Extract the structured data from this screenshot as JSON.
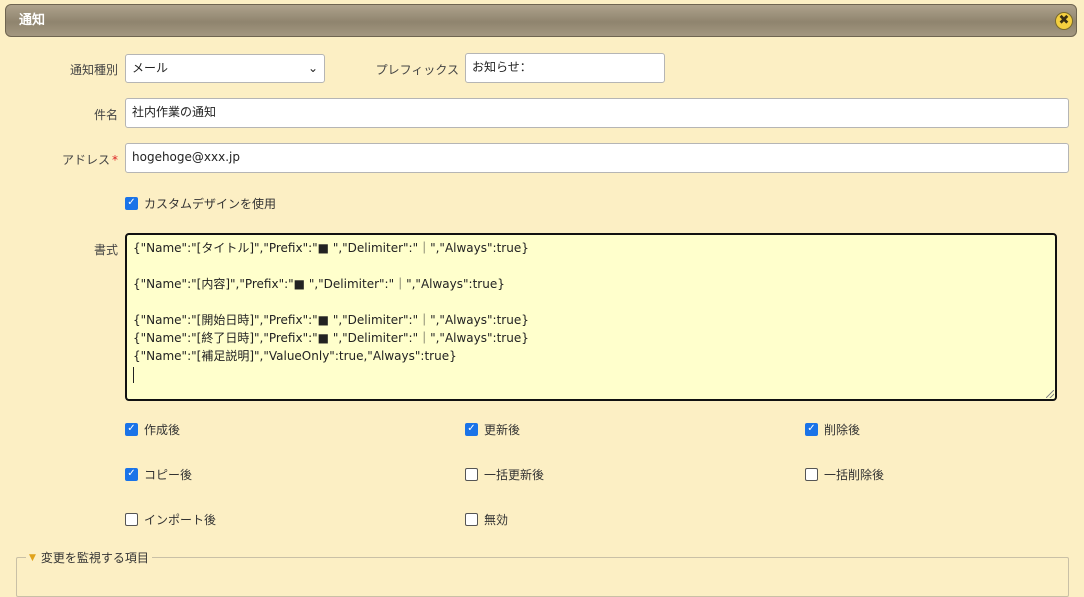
{
  "dialog": {
    "title": "通知",
    "close_label": "✖"
  },
  "form": {
    "notification_type": {
      "label": "通知種別",
      "value": "メール"
    },
    "prefix": {
      "label": "プレフィックス",
      "value": "お知らせ："
    },
    "subject": {
      "label": "件名",
      "value": "社内作業の通知"
    },
    "address": {
      "label": "アドレス",
      "required_mark": "*",
      "value": "hogehoge@xxx.jp"
    },
    "custom_design": {
      "label": "カスタムデザインを使用",
      "checked": true
    },
    "format": {
      "label": "書式",
      "lines": [
        "{\"Name\":\"[タイトル]\",\"Prefix\":\"■ \",\"Delimiter\":\"｜\",\"Always\":true}",
        "",
        "{\"Name\":\"[内容]\",\"Prefix\":\"■ \",\"Delimiter\":\"｜\",\"Always\":true}",
        "",
        "{\"Name\":\"[開始日時]\",\"Prefix\":\"■ \",\"Delimiter\":\"｜\",\"Always\":true}",
        "{\"Name\":\"[終了日時]\",\"Prefix\":\"■ \",\"Delimiter\":\"｜\",\"Always\":true}",
        "{\"Name\":\"[補足説明]\",\"ValueOnly\":true,\"Always\":true}"
      ]
    },
    "triggers": [
      {
        "label": "作成後",
        "checked": true
      },
      {
        "label": "更新後",
        "checked": true
      },
      {
        "label": "削除後",
        "checked": true
      },
      {
        "label": "コピー後",
        "checked": true
      },
      {
        "label": "一括更新後",
        "checked": false
      },
      {
        "label": "一括削除後",
        "checked": false
      },
      {
        "label": "インポート後",
        "checked": false
      },
      {
        "label": "無効",
        "checked": false
      }
    ],
    "monitor_section": {
      "label": "変更を監視する項目"
    }
  },
  "icons": {
    "close": "close-icon",
    "dropdown": "chevron-down-icon",
    "legend": "triangle-down-icon",
    "check": "check-icon"
  },
  "colors": {
    "background": "#fcefc4",
    "titlebar": "#9a8f78",
    "close_button": "#f4cf3f",
    "checkbox_checked": "#1a73e8",
    "textarea_bg": "#ffffcc",
    "required": "#dd2222"
  }
}
